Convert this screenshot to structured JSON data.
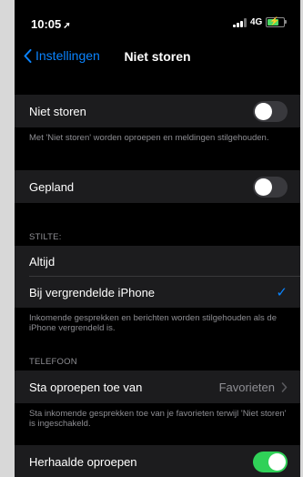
{
  "status": {
    "time": "10:05",
    "network": "4G"
  },
  "nav": {
    "back_label": "Instellingen",
    "title": "Niet storen"
  },
  "dnd": {
    "label": "Niet storen",
    "on": false,
    "footer": "Met 'Niet storen' worden oproepen en meldingen stilgehouden."
  },
  "scheduled": {
    "label": "Gepland",
    "on": false
  },
  "silence": {
    "header": "STILTE:",
    "always": "Altijd",
    "locked": "Bij vergrendelde iPhone",
    "footer": "Inkomende gesprekken en berichten worden stilgehouden als de iPhone vergrendeld is."
  },
  "phone": {
    "header": "TELEFOON",
    "allow_label": "Sta oproepen toe van",
    "allow_value": "Favorieten",
    "footer": "Sta inkomende gesprekken toe van je favorieten terwijl 'Niet storen' is ingeschakeld."
  },
  "repeated": {
    "label": "Herhaalde oproepen",
    "on": true
  },
  "colors": {
    "accent": "#0a84ff",
    "toggle_on": "#30d158"
  }
}
